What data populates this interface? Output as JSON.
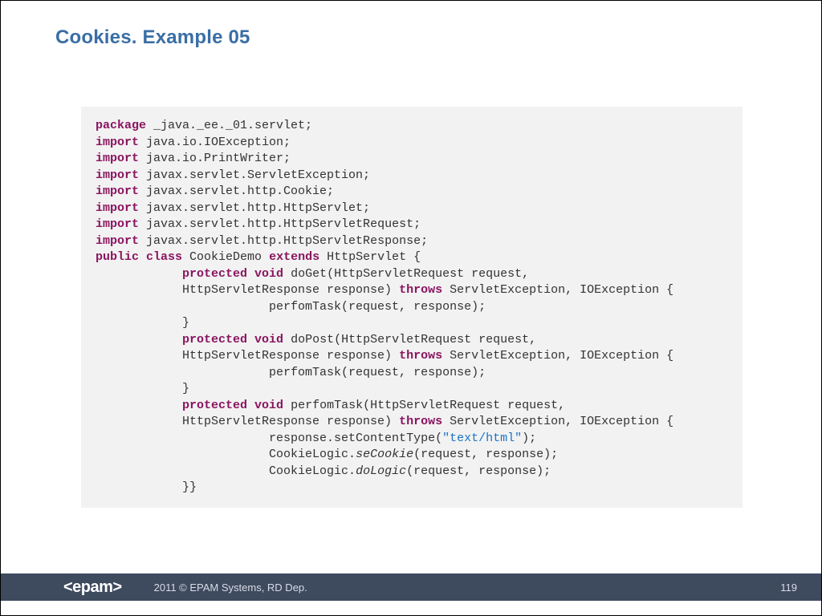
{
  "title": "Cookies. Example 05",
  "footer": {
    "logo": "<epam>",
    "copyright": "2011 © EPAM Systems, RD Dep.",
    "page": "119"
  },
  "code": {
    "tokens": [
      {
        "t": "kw",
        "v": "package"
      },
      {
        "t": "pl",
        "v": " _java._ee._01.servlet;"
      },
      {
        "t": "nl"
      },
      {
        "t": "kw",
        "v": "import"
      },
      {
        "t": "pl",
        "v": " java.io.IOException;"
      },
      {
        "t": "nl"
      },
      {
        "t": "kw",
        "v": "import"
      },
      {
        "t": "pl",
        "v": " java.io.PrintWriter;"
      },
      {
        "t": "nl"
      },
      {
        "t": "kw",
        "v": "import"
      },
      {
        "t": "pl",
        "v": " javax.servlet.ServletException;"
      },
      {
        "t": "nl"
      },
      {
        "t": "kw",
        "v": "import"
      },
      {
        "t": "pl",
        "v": " javax.servlet.http.Cookie;"
      },
      {
        "t": "nl"
      },
      {
        "t": "kw",
        "v": "import"
      },
      {
        "t": "pl",
        "v": " javax.servlet.http.HttpServlet;"
      },
      {
        "t": "nl"
      },
      {
        "t": "kw",
        "v": "import"
      },
      {
        "t": "pl",
        "v": " javax.servlet.http.HttpServletRequest;"
      },
      {
        "t": "nl"
      },
      {
        "t": "kw",
        "v": "import"
      },
      {
        "t": "pl",
        "v": " javax.servlet.http.HttpServletResponse;"
      },
      {
        "t": "nl"
      },
      {
        "t": "kw",
        "v": "public class"
      },
      {
        "t": "pl",
        "v": " CookieDemo "
      },
      {
        "t": "kw",
        "v": "extends"
      },
      {
        "t": "pl",
        "v": " HttpServlet {"
      },
      {
        "t": "nl"
      },
      {
        "t": "pl",
        "v": "            "
      },
      {
        "t": "kw",
        "v": "protected void"
      },
      {
        "t": "pl",
        "v": " doGet(HttpServletRequest request,"
      },
      {
        "t": "nl"
      },
      {
        "t": "pl",
        "v": "            HttpServletResponse response) "
      },
      {
        "t": "kw",
        "v": "throws"
      },
      {
        "t": "pl",
        "v": " ServletException, IOException {"
      },
      {
        "t": "nl"
      },
      {
        "t": "pl",
        "v": "                        perfomTask(request, response);"
      },
      {
        "t": "nl"
      },
      {
        "t": "pl",
        "v": "            }"
      },
      {
        "t": "nl"
      },
      {
        "t": "pl",
        "v": "            "
      },
      {
        "t": "kw",
        "v": "protected void"
      },
      {
        "t": "pl",
        "v": " doPost(HttpServletRequest request,"
      },
      {
        "t": "nl"
      },
      {
        "t": "pl",
        "v": "            HttpServletResponse response) "
      },
      {
        "t": "kw",
        "v": "throws"
      },
      {
        "t": "pl",
        "v": " ServletException, IOException {"
      },
      {
        "t": "nl"
      },
      {
        "t": "pl",
        "v": "                        perfomTask(request, response);"
      },
      {
        "t": "nl"
      },
      {
        "t": "pl",
        "v": "            }"
      },
      {
        "t": "nl"
      },
      {
        "t": "pl",
        "v": "            "
      },
      {
        "t": "kw",
        "v": "protected void"
      },
      {
        "t": "pl",
        "v": " perfomTask(HttpServletRequest request,"
      },
      {
        "t": "nl"
      },
      {
        "t": "pl",
        "v": "            HttpServletResponse response) "
      },
      {
        "t": "kw",
        "v": "throws"
      },
      {
        "t": "pl",
        "v": " ServletException, IOException {"
      },
      {
        "t": "nl"
      },
      {
        "t": "pl",
        "v": "                        response.setContentType("
      },
      {
        "t": "str",
        "v": "\"text/html\""
      },
      {
        "t": "pl",
        "v": ");"
      },
      {
        "t": "nl"
      },
      {
        "t": "pl",
        "v": "                        CookieLogic."
      },
      {
        "t": "em",
        "v": "seCookie"
      },
      {
        "t": "pl",
        "v": "(request, response);"
      },
      {
        "t": "nl"
      },
      {
        "t": "pl",
        "v": "                        CookieLogic."
      },
      {
        "t": "em",
        "v": "doLogic"
      },
      {
        "t": "pl",
        "v": "(request, response);"
      },
      {
        "t": "nl"
      },
      {
        "t": "pl",
        "v": "            }}"
      }
    ]
  }
}
